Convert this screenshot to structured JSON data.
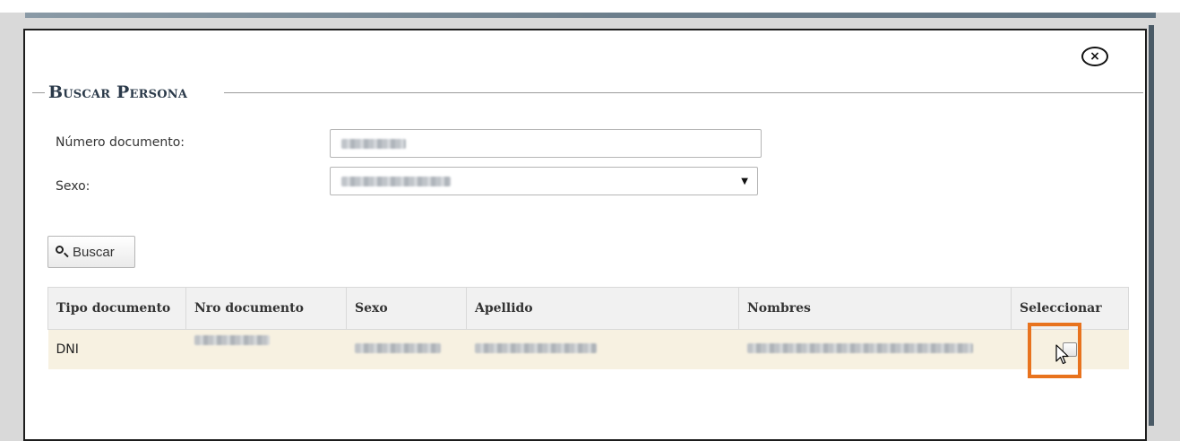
{
  "modal": {
    "close_symbol": "×",
    "legend": "Buscar Persona"
  },
  "form": {
    "doc_label": "Número documento:",
    "sex_label": "Sexo:",
    "search_button": "Buscar"
  },
  "table": {
    "headers": {
      "tipo": "Tipo documento",
      "nro": "Nro documento",
      "sexo": "Sexo",
      "apellido": "Apellido",
      "nombres": "Nombres",
      "seleccionar": "Seleccionar"
    },
    "rows": [
      {
        "tipo": "DNI"
      }
    ]
  },
  "colors": {
    "highlight": "#e8731e",
    "row_bg": "#f7f1e1",
    "legend_text": "#2b3a4a"
  },
  "icons": {
    "close": "close-icon",
    "search": "search-icon",
    "dropdown": "chevron-down-icon",
    "cursor": "mouse-pointer-icon"
  }
}
